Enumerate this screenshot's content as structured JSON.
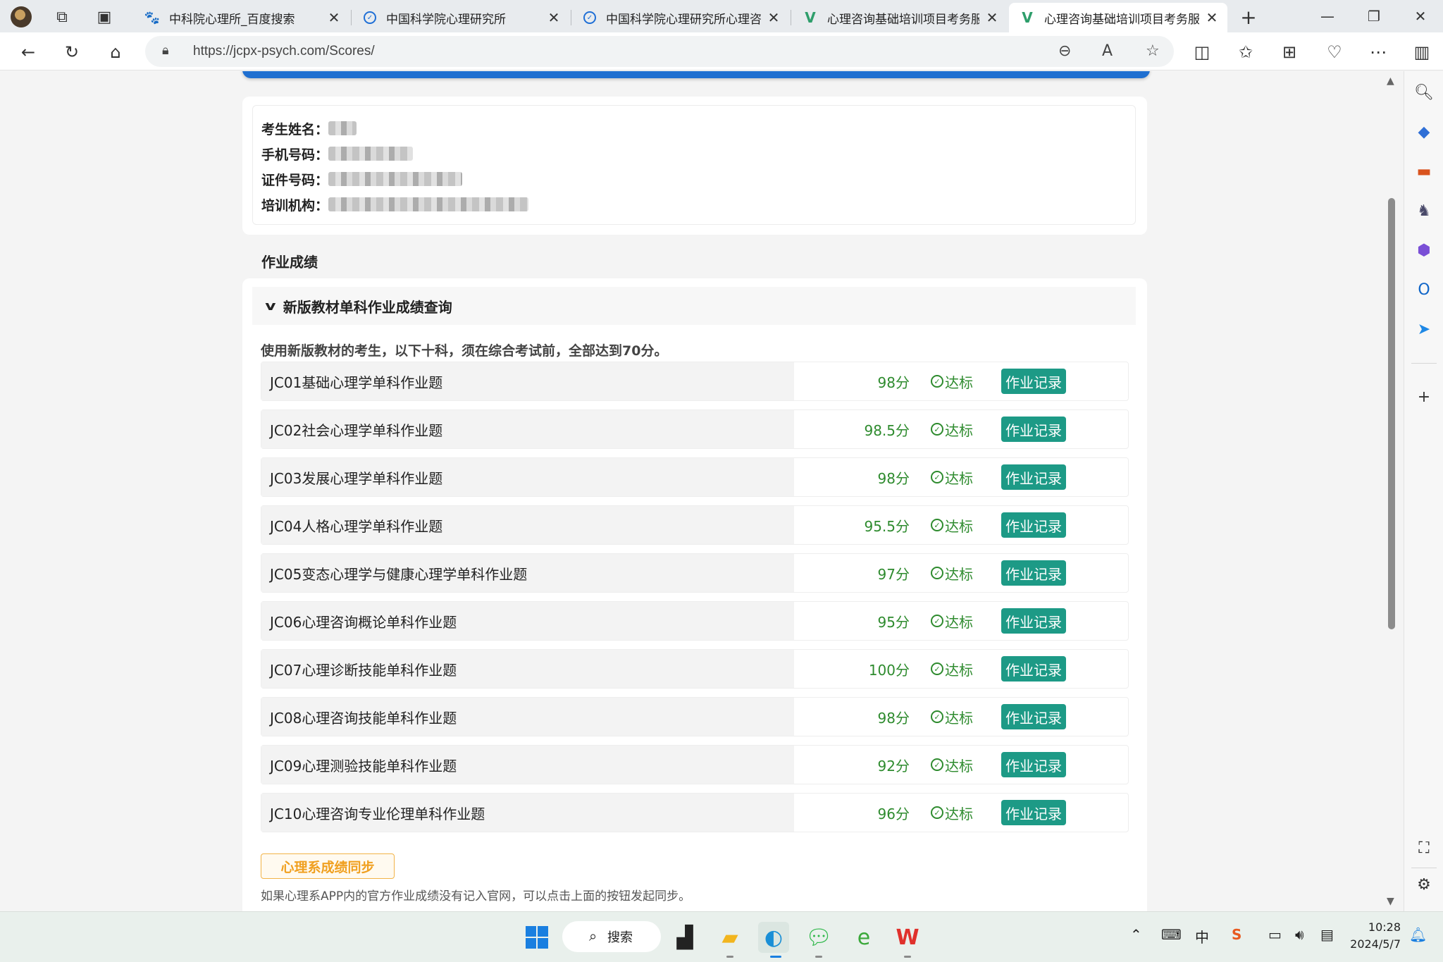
{
  "browser": {
    "tabs": [
      {
        "title": "中科院心理所_百度搜索",
        "favicon": "baidu-icon",
        "active": false
      },
      {
        "title": "中国科学院心理研究所",
        "favicon": "cas-icon",
        "active": false
      },
      {
        "title": "中国科学院心理研究所心理咨",
        "favicon": "cas-icon",
        "active": false
      },
      {
        "title": "心理咨询基础培训项目考务服",
        "favicon": "vue-icon",
        "active": false
      },
      {
        "title": "心理咨询基础培训项目考务服",
        "favicon": "vue-icon",
        "active": true
      }
    ],
    "url": "https://jcpx-psych.com/Scores/"
  },
  "profile": {
    "name_label": "考生姓名：",
    "phone_label": "手机号码：",
    "id_label": "证件号码：",
    "org_label": "培训机构："
  },
  "section": {
    "title": "作业成绩",
    "collapse_title": "新版教材单科作业成绩查询",
    "note": "使用新版教材的考生，以下十科，须在综合考试前，全部达到70分。"
  },
  "scores": [
    {
      "name": "JC01基础心理学单科作业题",
      "score": "98分",
      "status": "达标",
      "button": "作业记录"
    },
    {
      "name": "JC02社会心理学单科作业题",
      "score": "98.5分",
      "status": "达标",
      "button": "作业记录"
    },
    {
      "name": "JC03发展心理学单科作业题",
      "score": "98分",
      "status": "达标",
      "button": "作业记录"
    },
    {
      "name": "JC04人格心理学单科作业题",
      "score": "95.5分",
      "status": "达标",
      "button": "作业记录"
    },
    {
      "name": "JC05变态心理学与健康心理学单科作业题",
      "score": "97分",
      "status": "达标",
      "button": "作业记录"
    },
    {
      "name": "JC06心理咨询概论单科作业题",
      "score": "95分",
      "status": "达标",
      "button": "作业记录"
    },
    {
      "name": "JC07心理诊断技能单科作业题",
      "score": "100分",
      "status": "达标",
      "button": "作业记录"
    },
    {
      "name": "JC08心理咨询技能单科作业题",
      "score": "98分",
      "status": "达标",
      "button": "作业记录"
    },
    {
      "name": "JC09心理测验技能单科作业题",
      "score": "92分",
      "status": "达标",
      "button": "作业记录"
    },
    {
      "name": "JC10心理咨询专业伦理单科作业题",
      "score": "96分",
      "status": "达标",
      "button": "作业记录"
    }
  ],
  "sync": {
    "button": "心理系成绩同步",
    "note": "如果心理系APP内的官方作业成绩没有记入官网，可以点击上面的按钮发起同步。"
  },
  "taskbar": {
    "search_label": "搜索",
    "ime": "中",
    "time": "10:28",
    "date": "2024/5/7"
  },
  "colors": {
    "accent_green": "#1d9a86",
    "score_green": "#2e8b2e",
    "top_bar_blue": "#1f6fd0",
    "sync_orange": "#f0a020"
  }
}
